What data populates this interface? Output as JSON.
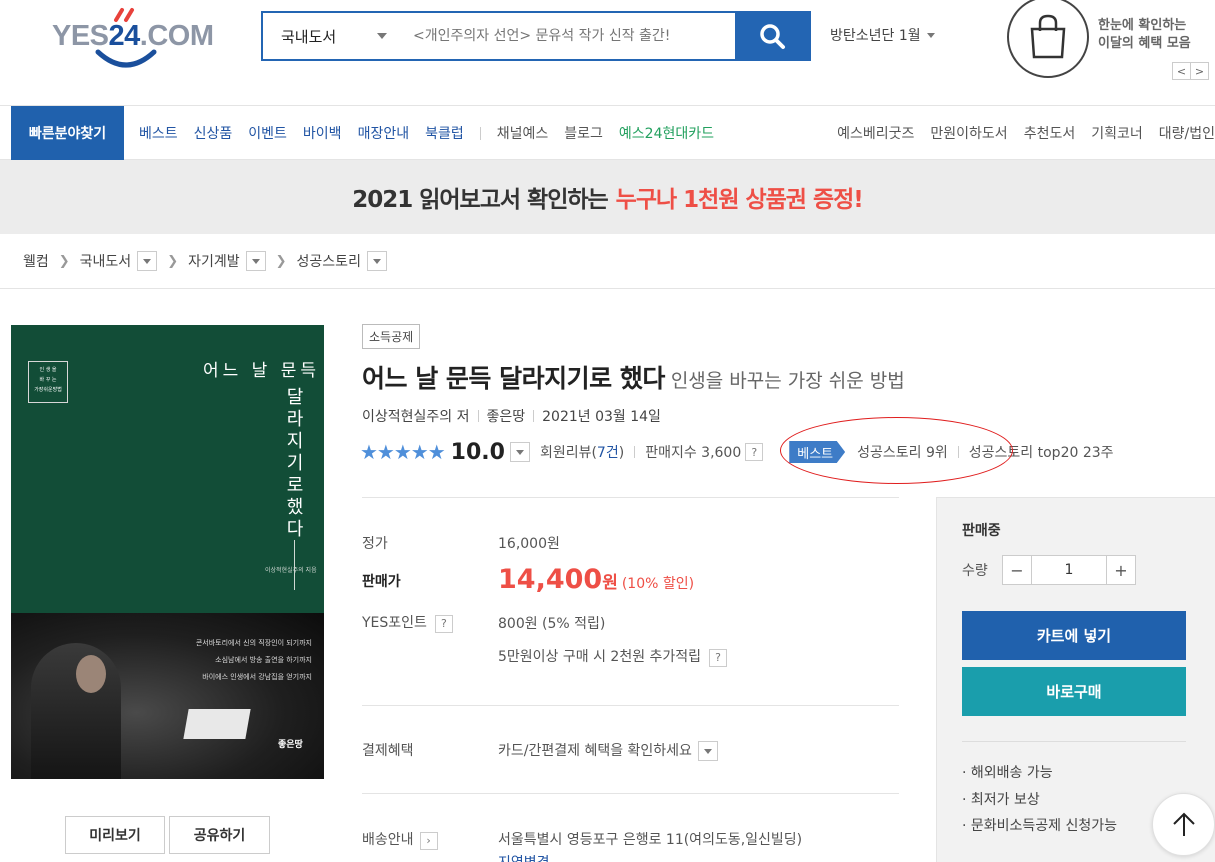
{
  "header": {
    "logo_text": "YES24.COM",
    "search_category": "국내도서",
    "search_placeholder": "<개인주의자 선언> 문유석 작가 신작 출간!",
    "hot_keyword": "방탄소년단 1월",
    "benefit_line1": "한눈에 확인하는",
    "benefit_line2": "이달의 혜택 모음",
    "prev": "<",
    "next": ">"
  },
  "gnb": {
    "category_button": "빠른분야찾기",
    "left_items": [
      "베스트",
      "신상품",
      "이벤트",
      "바이백",
      "매장안내",
      "북클럽"
    ],
    "gray_items": [
      "채널예스",
      "블로그"
    ],
    "card_item": "예스24현대카드",
    "right_items": [
      "예스베리굿즈",
      "만원이하도서",
      "추천도서",
      "기획코너",
      "대량/법인"
    ]
  },
  "banner": {
    "text": "2021 읽어보고서 확인하는",
    "highlight": "누구나 1천원 상품권 증정!"
  },
  "breadcrumb": [
    "웰컴",
    "국내도서",
    "자기계발",
    "성공스토리"
  ],
  "cover": {
    "badge": [
      "인 생 을",
      "바 꾸 는",
      "가장쉬운방법"
    ],
    "title_line": "어느 날 문득",
    "vertical_title": [
      "달",
      "라",
      "지",
      "기",
      "로",
      "했",
      "다"
    ],
    "author_line": "이상적현실주의 지음",
    "caption": [
      "콘서바토리에서 신의 직장인이 되기까지",
      "소심남에서 방송 출연을 하기까지",
      "바이에스 인생에서 강남집을 얻기까지"
    ],
    "publisher": "좋은땅",
    "buttons": [
      "미리보기",
      "공유하기"
    ]
  },
  "product": {
    "tag": "소득공제",
    "title": "어느 날 문득 달라지기로 했다",
    "subtitle": "인생을 바꾸는 가장 쉬운 방법",
    "author": "이상적현실주의 저",
    "publisher": "좋은땅",
    "date": "2021년 03월 14일",
    "stars": "★★★★★",
    "score": "10.0",
    "review_label": "회원리뷰(",
    "review_count": "7건",
    "review_close": ")",
    "sales_index": "판매지수 3,600",
    "best_tag": "베스트",
    "rank": "성공스토리 9위",
    "top20": "성공스토리 top20 23주"
  },
  "price": {
    "list_label": "정가",
    "list_value": "16,000원",
    "sale_label": "판매가",
    "sale_value": "14,400",
    "sale_unit": "원",
    "discount": "(10% 할인)",
    "point_label": "YES포인트",
    "point_value": "800원 (5% 적립)",
    "point_extra": "5만원이상 구매 시 2천원 추가적립",
    "pay_label": "결제혜택",
    "pay_value": "카드/간편결제 혜택을 확인하세요",
    "ship_label": "배송안내",
    "ship_value": "서울특별시 영등포구 은행로 11(여의도동,일신빌딩)",
    "ship_change": "지역변경"
  },
  "side": {
    "status": "판매중",
    "qty_label": "수량",
    "qty_value": "1",
    "minus": "−",
    "plus": "+",
    "cart": "카트에 넣기",
    "buy": "바로구매",
    "benefits": [
      "해외배송 가능",
      "최저가 보상",
      "문화비소득공제 신청가능"
    ]
  },
  "colors": {
    "brand_blue": "#2061ad",
    "sale_red": "#ee4f46",
    "buy_teal": "#1a9eac"
  }
}
